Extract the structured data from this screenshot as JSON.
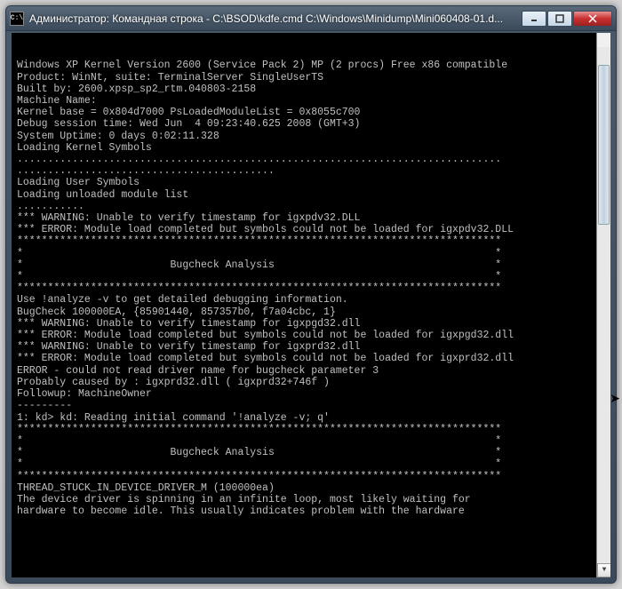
{
  "titlebar": {
    "icon_label": "C:\\",
    "text": "Администратор: Командная строка - C:\\BSOD\\kdfe.cmd  C:\\Windows\\Minidump\\Mini060408-01.d..."
  },
  "window_buttons": {
    "minimize_name": "minimize",
    "maximize_name": "maximize",
    "close_name": "close"
  },
  "terminal": {
    "lines": [
      "Windows XP Kernel Version 2600 (Service Pack 2) MP (2 procs) Free x86 compatible",
      "",
      "Product: WinNt, suite: TerminalServer SingleUserTS",
      "Built by: 2600.xpsp_sp2_rtm.040803-2158",
      "Machine Name:",
      "Kernel base = 0x804d7000 PsLoadedModuleList = 0x8055c700",
      "Debug session time: Wed Jun  4 09:23:40.625 2008 (GMT+3)",
      "System Uptime: 0 days 0:02:11.328",
      "Loading Kernel Symbols",
      "...............................................................................",
      "..........................................",
      "Loading User Symbols",
      "Loading unloaded module list",
      "...........",
      "*** WARNING: Unable to verify timestamp for igxpdv32.DLL",
      "*** ERROR: Module load completed but symbols could not be loaded for igxpdv32.DLL",
      "*******************************************************************************",
      "*                                                                             *",
      "*                        Bugcheck Analysis                                    *",
      "*                                                                             *",
      "*******************************************************************************",
      "",
      "Use !analyze -v to get detailed debugging information.",
      "",
      "BugCheck 100000EA, {85901440, 857357b0, f7a04cbc, 1}",
      "",
      "*** WARNING: Unable to verify timestamp for igxpgd32.dll",
      "*** ERROR: Module load completed but symbols could not be loaded for igxpgd32.dll",
      "*** WARNING: Unable to verify timestamp for igxprd32.dll",
      "*** ERROR: Module load completed but symbols could not be loaded for igxprd32.dll",
      "ERROR - could not read driver name for bugcheck parameter 3",
      "",
      "Probably caused by : igxprd32.dll ( igxprd32+746f )",
      "",
      "Followup: MachineOwner",
      "---------",
      "",
      "1: kd> kd: Reading initial command '!analyze -v; q'",
      "*******************************************************************************",
      "*                                                                             *",
      "*                        Bugcheck Analysis                                    *",
      "*                                                                             *",
      "*******************************************************************************",
      "",
      "THREAD_STUCK_IN_DEVICE_DRIVER_M (100000ea)",
      "The device driver is spinning in an infinite loop, most likely waiting for",
      "hardware to become idle. This usually indicates problem with the hardware"
    ]
  }
}
